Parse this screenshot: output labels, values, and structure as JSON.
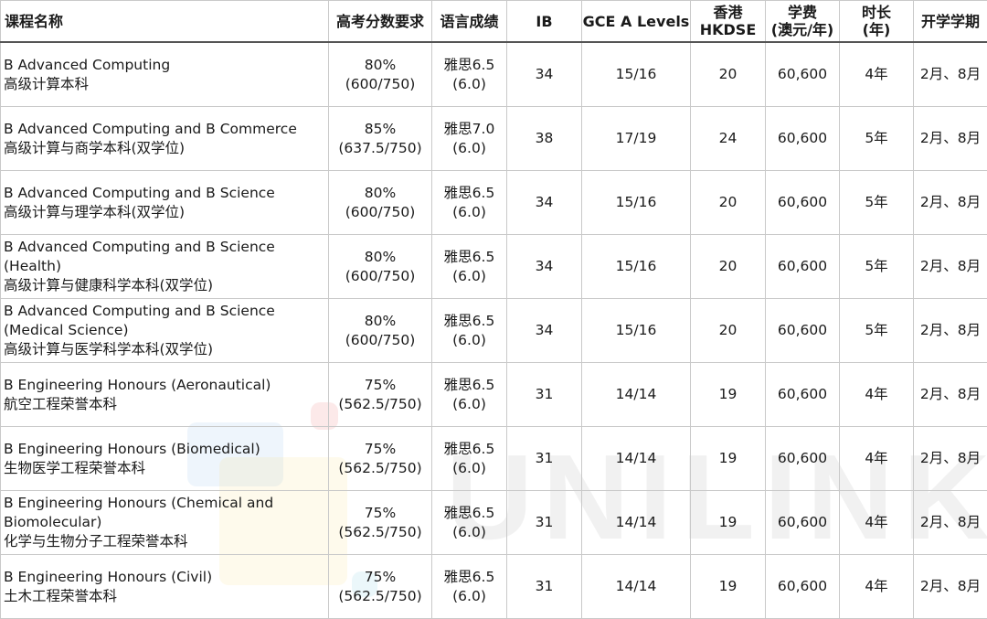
{
  "table": {
    "headers": [
      [
        "课程名称"
      ],
      [
        "高考分数要求"
      ],
      [
        "语言成绩"
      ],
      [
        "IB"
      ],
      [
        "GCE A Levels"
      ],
      [
        "香港",
        "HKDSE"
      ],
      [
        "学费",
        "(澳元/年)"
      ],
      [
        "时长",
        "(年)"
      ],
      [
        "开学学期"
      ]
    ],
    "rows": [
      {
        "name_en": "B Advanced Computing",
        "name_cn": "高级计算本科",
        "gaokao": "80%",
        "gaokao_score": "(600/750)",
        "lang": "雅思6.5",
        "lang_sub": "(6.0)",
        "ib": "34",
        "alevel": "15/16",
        "hkdse": "20",
        "fee": "60,600",
        "duration": "4年",
        "intake": "2月、8月"
      },
      {
        "name_en": "B Advanced Computing and B Commerce",
        "name_cn": "高级计算与商学本科(双学位)",
        "gaokao": "85%",
        "gaokao_score": "(637.5/750)",
        "lang": "雅思7.0",
        "lang_sub": "(6.0)",
        "ib": "38",
        "alevel": "17/19",
        "hkdse": "24",
        "fee": "60,600",
        "duration": "5年",
        "intake": "2月、8月"
      },
      {
        "name_en": "B Advanced Computing and B Science",
        "name_cn": "高级计算与理学本科(双学位)",
        "gaokao": "80%",
        "gaokao_score": "(600/750)",
        "lang": "雅思6.5",
        "lang_sub": "(6.0)",
        "ib": "34",
        "alevel": "15/16",
        "hkdse": "20",
        "fee": "60,600",
        "duration": "5年",
        "intake": "2月、8月"
      },
      {
        "name_en": "B Advanced Computing and B Science (Health)",
        "name_cn": "高级计算与健康科学本科(双学位)",
        "gaokao": "80%",
        "gaokao_score": "(600/750)",
        "lang": "雅思6.5",
        "lang_sub": "(6.0)",
        "ib": "34",
        "alevel": "15/16",
        "hkdse": "20",
        "fee": "60,600",
        "duration": "5年",
        "intake": "2月、8月"
      },
      {
        "name_en": "B Advanced Computing and B Science (Medical Science)",
        "name_cn": "高级计算与医学科学本科(双学位)",
        "gaokao": "80%",
        "gaokao_score": "(600/750)",
        "lang": "雅思6.5",
        "lang_sub": "(6.0)",
        "ib": "34",
        "alevel": "15/16",
        "hkdse": "20",
        "fee": "60,600",
        "duration": "5年",
        "intake": "2月、8月"
      },
      {
        "name_en": "B Engineering Honours (Aeronautical)",
        "name_cn": "航空工程荣誉本科",
        "gaokao": "75%",
        "gaokao_score": "(562.5/750)",
        "lang": "雅思6.5",
        "lang_sub": "(6.0)",
        "ib": "31",
        "alevel": "14/14",
        "hkdse": "19",
        "fee": "60,600",
        "duration": "4年",
        "intake": "2月、8月"
      },
      {
        "name_en": "B Engineering Honours (Biomedical)",
        "name_cn": "生物医学工程荣誉本科",
        "gaokao": "75%",
        "gaokao_score": "(562.5/750)",
        "lang": "雅思6.5",
        "lang_sub": "(6.0)",
        "ib": "31",
        "alevel": "14/14",
        "hkdse": "19",
        "fee": "60,600",
        "duration": "4年",
        "intake": "2月、8月"
      },
      {
        "name_en": "B Engineering Honours (Chemical and Biomolecular)",
        "name_cn": "化学与生物分子工程荣誉本科",
        "gaokao": "75%",
        "gaokao_score": "(562.5/750)",
        "lang": "雅思6.5",
        "lang_sub": "(6.0)",
        "ib": "31",
        "alevel": "14/14",
        "hkdse": "19",
        "fee": "60,600",
        "duration": "4年",
        "intake": "2月、8月"
      },
      {
        "name_en": "B Engineering Honours (Civil)",
        "name_cn": "土木工程荣誉本科",
        "gaokao": "75%",
        "gaokao_score": "(562.5/750)",
        "lang": "雅思6.5",
        "lang_sub": "(6.0)",
        "ib": "31",
        "alevel": "14/14",
        "hkdse": "19",
        "fee": "60,600",
        "duration": "4年",
        "intake": "2月、8月"
      }
    ]
  },
  "watermark": {
    "text": "UNILINK"
  },
  "colors": {
    "border": "#c9c9c9",
    "header_rule": "#555555",
    "text": "#1a1a1a"
  }
}
